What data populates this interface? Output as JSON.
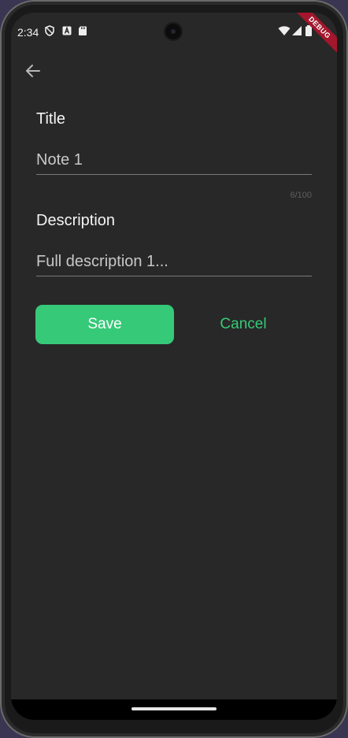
{
  "status": {
    "time": "2:34",
    "icons": [
      "shield-icon",
      "a-icon",
      "sd-card-icon",
      "wifi-icon",
      "signal-icon",
      "battery-icon"
    ]
  },
  "debug_banner": "DEBUG",
  "form": {
    "title_label": "Title",
    "title_value": "Note 1",
    "title_counter": "6/100",
    "description_label": "Description",
    "description_value": "Full description 1..."
  },
  "actions": {
    "save_label": "Save",
    "cancel_label": "Cancel"
  },
  "colors": {
    "background": "#282828",
    "accent": "#36c978",
    "debug": "#a3162c"
  }
}
